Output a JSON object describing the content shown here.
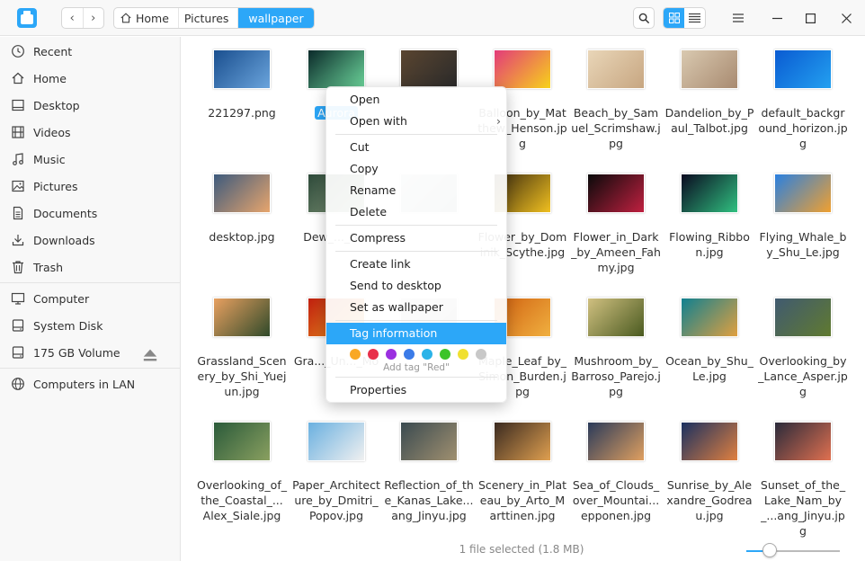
{
  "nav": {
    "back": "‹",
    "forward": "›"
  },
  "breadcrumbs": [
    "Home",
    "Pictures",
    "wallpaper"
  ],
  "sidebar": {
    "items": [
      {
        "label": "Recent",
        "icon": "clock-icon"
      },
      {
        "label": "Home",
        "icon": "home-icon"
      },
      {
        "label": "Desktop",
        "icon": "desktop-icon"
      },
      {
        "label": "Videos",
        "icon": "video-icon"
      },
      {
        "label": "Music",
        "icon": "music-icon"
      },
      {
        "label": "Pictures",
        "icon": "picture-icon"
      },
      {
        "label": "Documents",
        "icon": "document-icon"
      },
      {
        "label": "Downloads",
        "icon": "download-icon"
      },
      {
        "label": "Trash",
        "icon": "trash-icon"
      }
    ],
    "devices": [
      {
        "label": "Computer",
        "icon": "computer-icon"
      },
      {
        "label": "System Disk",
        "icon": "disk-icon"
      },
      {
        "label": "175 GB Volume",
        "icon": "disk-icon"
      }
    ],
    "network": [
      {
        "label": "Computers in LAN",
        "icon": "network-icon"
      }
    ]
  },
  "files": [
    {
      "name": "221297.png",
      "c1": "#1a4f8f",
      "c2": "#6aa4dc"
    },
    {
      "name": "Aurora",
      "c1": "#0b2a2a",
      "c2": "#6bd49a",
      "selected": true
    },
    {
      "name": "",
      "c1": "#5a4530",
      "c2": "#2a2a2a"
    },
    {
      "name": "Balloon_by_Matthew_Henson.jpg",
      "c1": "#e33b7a",
      "c2": "#f7d21a"
    },
    {
      "name": "Beach_by_Samuel_Scrimshaw.jpg",
      "c1": "#e9d6b8",
      "c2": "#c7a681"
    },
    {
      "name": "Dandelion_by_Paul_Talbot.jpg",
      "c1": "#d9c9b0",
      "c2": "#a88a70"
    },
    {
      "name": "default_background_horizon.jpg",
      "c1": "#0a5bd2",
      "c2": "#23a0f0"
    },
    {
      "name": "desktop.jpg",
      "c1": "#3d5a7d",
      "c2": "#e7a56d"
    },
    {
      "name": "Dew_..._Bur",
      "c1": "#2e4a3a",
      "c2": "#8aa080"
    },
    {
      "name": "",
      "c1": "#c8d0d0",
      "c2": "#98a8a8"
    },
    {
      "name": "Flower_by_Dominik_Scythe.jpg",
      "c1": "#3a2a10",
      "c2": "#f0c020"
    },
    {
      "name": "Flower_in_Dark_by_Ameen_Fahmy.jpg",
      "c1": "#0a0a0a",
      "c2": "#c02040"
    },
    {
      "name": "Flowing_Ribbon.jpg",
      "c1": "#0a0a20",
      "c2": "#30c080"
    },
    {
      "name": "Flying_Whale_by_Shu_Le.jpg",
      "c1": "#2a80e0",
      "c2": "#f0a030"
    },
    {
      "name": "Grassland_Scenery_by_Shi_Yuejun.jpg",
      "c1": "#e8a060",
      "c2": "#304a2a"
    },
    {
      "name": "Gra..._Un..._Mo",
      "c1": "#c02010",
      "c2": "#f0a020"
    },
    {
      "name": "",
      "c1": "#d0d0d0",
      "c2": "#a0a0a0"
    },
    {
      "name": "Maple_Leaf_by_Simon_Burden.jpg",
      "c1": "#d06010",
      "c2": "#f0b040"
    },
    {
      "name": "Mushroom_by_Barroso_Parejo.jpg",
      "c1": "#d0c080",
      "c2": "#4a5a20"
    },
    {
      "name": "Ocean_by_Shu_Le.jpg",
      "c1": "#108090",
      "c2": "#e0a040"
    },
    {
      "name": "Overlooking_by_Lance_Asper.jpg",
      "c1": "#405a70",
      "c2": "#607a30"
    },
    {
      "name": "Overlooking_of_the_Coastal_...Alex_Siale.jpg",
      "c1": "#2a5a3a",
      "c2": "#8aa060"
    },
    {
      "name": "Paper_Architecture_by_Dmitri_Popov.jpg",
      "c1": "#6ab0e0",
      "c2": "#f0f0f0"
    },
    {
      "name": "Reflection_of_the_Kanas_Lake...ang_Jinyu.jpg",
      "c1": "#3a4a50",
      "c2": "#a09070"
    },
    {
      "name": "Scenery_in_Plateau_by_Arto_Marttinen.jpg",
      "c1": "#3a2a20",
      "c2": "#e0a050"
    },
    {
      "name": "Sea_of_Clouds_over_Mountai...epponen.jpg",
      "c1": "#2a3a5a",
      "c2": "#e0a060"
    },
    {
      "name": "Sunrise_by_Alexandre_Godreau.jpg",
      "c1": "#1a3060",
      "c2": "#e08040"
    },
    {
      "name": "Sunset_of_the_Lake_Nam_by_...ang_Jinyu.jpg",
      "c1": "#2a2a3a",
      "c2": "#e07050"
    }
  ],
  "context_menu": {
    "items": [
      "Open",
      "Open with",
      "Cut",
      "Copy",
      "Rename",
      "Delete",
      "Compress",
      "Create link",
      "Send to desktop",
      "Set as wallpaper",
      "Tag information",
      "Properties"
    ],
    "submenu_arrow": "›",
    "tag_colors": [
      "#f9a825",
      "#e8304a",
      "#9b30e0",
      "#3b7be8",
      "#2ab3e8",
      "#3cc42a",
      "#f0e030",
      "#c8c8c8"
    ],
    "tag_hint": "Add tag \"Red\""
  },
  "status": {
    "text": "1 file selected (1.8 MB)",
    "zoom_fraction": 0.25
  },
  "colors": {
    "accent": "#2ca7f8"
  }
}
